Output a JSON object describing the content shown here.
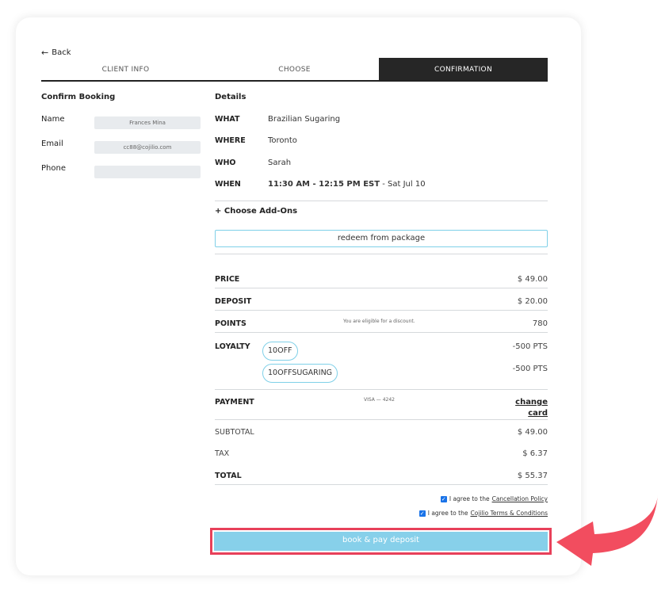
{
  "nav": {
    "back_label": "Back"
  },
  "tabs": [
    {
      "label": "CLIENT INFO",
      "active": false
    },
    {
      "label": "CHOOSE",
      "active": false
    },
    {
      "label": "CONFIRMATION",
      "active": true
    }
  ],
  "confirm": {
    "title": "Confirm Booking",
    "name_label": "Name",
    "name_value": "Frances Mina",
    "email_label": "Email",
    "email_value": "cc88@cojilio.com",
    "phone_label": "Phone",
    "phone_value": ""
  },
  "details": {
    "title": "Details",
    "what_label": "WHAT",
    "what_value": "Brazilian Sugaring",
    "where_label": "WHERE",
    "where_value": "Toronto",
    "who_label": "WHO",
    "who_value": "Sarah",
    "when_label": "WHEN",
    "when_time": "11:30 AM - 12:15 PM EST",
    "when_date": " - Sat Jul 10"
  },
  "addons_label": "+ Choose Add-Ons",
  "redeem_label": "redeem from package",
  "summary": {
    "price_label": "PRICE",
    "price_value": "$ 49.00",
    "deposit_label": "DEPOSIT",
    "deposit_value": "$ 20.00",
    "points_label": "POINTS",
    "points_note": "You are eligible for a discount.",
    "points_value": "780",
    "loyalty_label": "LOYALTY",
    "loyalty": [
      {
        "code": "10OFF",
        "value": "-500 PTS"
      },
      {
        "code": "10OFFSUGARING",
        "value": "-500 PTS"
      }
    ],
    "payment_label": "PAYMENT",
    "payment_card": "VISA — 4242",
    "change_card_line1": "change",
    "change_card_line2": "card",
    "subtotal_label": "SUBTOTAL",
    "subtotal_value": "$ 49.00",
    "tax_label": "TAX",
    "tax_value": "$ 6.37",
    "total_label": "TOTAL",
    "total_value": "$ 55.37"
  },
  "agreements": {
    "cancel_prefix": "I agree to the",
    "cancel_link": "Cancellation Policy",
    "terms_prefix": "I agree to the",
    "terms_link": "Cojilio Terms & Conditions"
  },
  "book_button_label": "book & pay deposit",
  "colors": {
    "accent": "#87d0ea",
    "highlight": "#e8405a",
    "tab_active": "#262626"
  }
}
